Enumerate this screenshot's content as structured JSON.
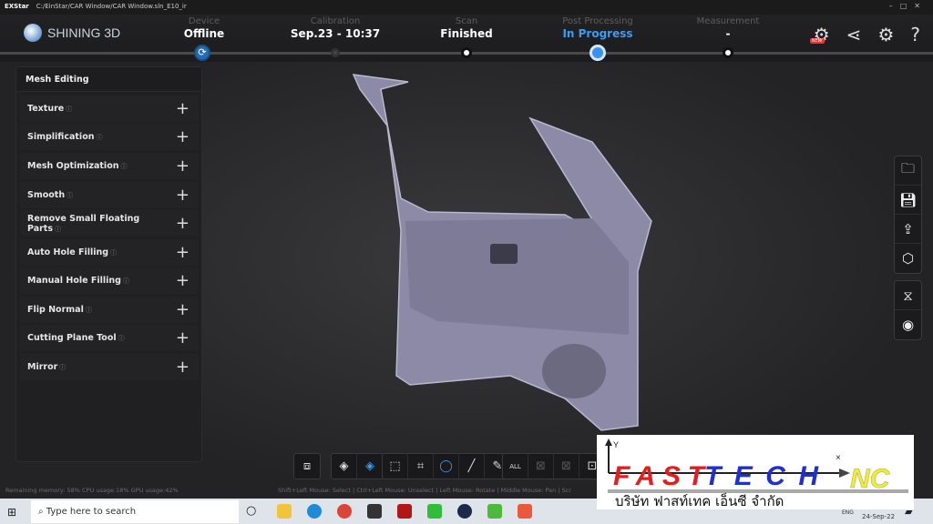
{
  "titlebar": {
    "app": "EXStar",
    "path": "C:/EinStar/CAR Window/CAR Window.sln_E10_ir"
  },
  "brand": "SHINING 3D",
  "steps": [
    {
      "label": "Device",
      "value": "Offline",
      "state": "sync"
    },
    {
      "label": "Calibration",
      "value": "Sep.23 - 10:37",
      "state": "done"
    },
    {
      "label": "Scan",
      "value": "Finished",
      "state": "done"
    },
    {
      "label": "Post Processing",
      "value": "In Progress",
      "state": "active"
    },
    {
      "label": "Measurement",
      "value": "-",
      "state": "pending"
    }
  ],
  "header_icons": [
    "device-new-icon",
    "share-icon",
    "settings-icon",
    "help-icon"
  ],
  "header_badge": "NEW",
  "panel": {
    "title": "Mesh Editing",
    "items": [
      {
        "label": "Texture"
      },
      {
        "label": "Simplification"
      },
      {
        "label": "Mesh Optimization"
      },
      {
        "label": "Smooth"
      },
      {
        "label": "Remove Small Floating Parts"
      },
      {
        "label": "Auto Hole Filling"
      },
      {
        "label": "Manual Hole Filling"
      },
      {
        "label": "Flip Normal"
      },
      {
        "label": "Cutting Plane Tool"
      },
      {
        "label": "Mirror"
      }
    ]
  },
  "right_toolbar": [
    "folder-icon",
    "save-icon",
    "export-icon",
    "view-cube-icon",
    "mesh-icon",
    "eye-icon"
  ],
  "bottom_toolbar": [
    "fit-view-icon",
    "layers-icon",
    "layers-select-icon",
    "rect-select-icon",
    "poly-select-icon",
    "lasso-icon",
    "line-select-icon",
    "brush-icon",
    "select-all-icon",
    "invert-icon",
    "deselect-icon",
    "delete-icon"
  ],
  "status": {
    "memory": "Remaining memory: 58% CPU usage:18% GPU usage:42%",
    "hint": "Shift+Left Mouse: Select | Ctrl+Left Mouse: Unselect | Left Mouse: Rotate | Middle Mouse: Pan | Scr"
  },
  "taskbar": {
    "search_placeholder": "Type here to search",
    "lang": "ENG",
    "date": "24-Sep-22"
  },
  "watermark": {
    "name": "FASTTECH NC",
    "thai": "บริษัท ฟาสท์เทค เอ็นซี จำกัด",
    "axis_y": "Y",
    "axis_x": "x"
  },
  "colors": {
    "accent": "#3d9bf0",
    "mesh": "#9a98b4"
  }
}
